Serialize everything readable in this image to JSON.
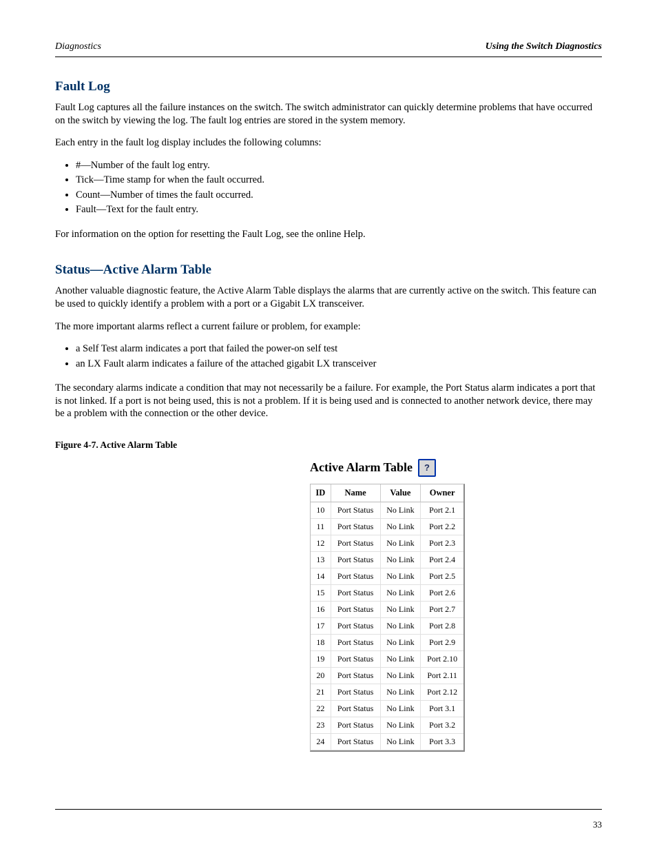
{
  "header": {
    "left": "Diagnostics",
    "right": "Using the Switch Diagnostics"
  },
  "footer": {
    "page": "33"
  },
  "section1": {
    "heading": "Fault Log",
    "p1": "Fault Log captures all the failure instances on the switch. The switch administrator can quickly determine problems that have occurred on the switch by viewing the log. The fault log entries are stored in the system memory.",
    "p2": "Each entry in the fault log display includes the following columns:",
    "bullets": [
      "#—Number of the fault log entry.",
      "Tick—Time stamp for when the fault occurred.",
      "Count—Number of times the fault occurred.",
      "Fault—Text for the fault entry."
    ],
    "p3": "For information on the option for resetting the Fault Log, see the online Help."
  },
  "section2": {
    "heading": "Status—Active Alarm Table",
    "p1": "Another valuable diagnostic feature, the Active Alarm Table displays the alarms that are currently active on the switch. This feature can be used to quickly identify a problem with a port or a Gigabit LX transceiver.",
    "p2": "The more important alarms reflect a current failure or problem, for example:",
    "bullets": [
      "a Self Test alarm indicates a port that failed the power-on self test",
      "an LX Fault alarm indicates a failure of the attached gigabit LX transceiver"
    ],
    "p3": "The secondary alarms indicate a condition that may not necessarily be a failure. For example, the Port Status alarm indicates a port that is not linked. If a port is not being used, this is not a problem. If it is being used and is connected to another network device, there may be a problem with the connection or the other device.",
    "fig_label": "Figure 4-7.  Active Alarm Table",
    "fig_title": "Active Alarm Table",
    "table": {
      "headers": [
        "ID",
        "Name",
        "Value",
        "Owner"
      ],
      "rows": [
        {
          "id": "10",
          "name": "Port Status",
          "value": "No Link",
          "owner": "Port 2.1"
        },
        {
          "id": "11",
          "name": "Port Status",
          "value": "No Link",
          "owner": "Port 2.2"
        },
        {
          "id": "12",
          "name": "Port Status",
          "value": "No Link",
          "owner": "Port 2.3"
        },
        {
          "id": "13",
          "name": "Port Status",
          "value": "No Link",
          "owner": "Port 2.4"
        },
        {
          "id": "14",
          "name": "Port Status",
          "value": "No Link",
          "owner": "Port 2.5"
        },
        {
          "id": "15",
          "name": "Port Status",
          "value": "No Link",
          "owner": "Port 2.6"
        },
        {
          "id": "16",
          "name": "Port Status",
          "value": "No Link",
          "owner": "Port 2.7"
        },
        {
          "id": "17",
          "name": "Port Status",
          "value": "No Link",
          "owner": "Port 2.8"
        },
        {
          "id": "18",
          "name": "Port Status",
          "value": "No Link",
          "owner": "Port 2.9"
        },
        {
          "id": "19",
          "name": "Port Status",
          "value": "No Link",
          "owner": "Port 2.10"
        },
        {
          "id": "20",
          "name": "Port Status",
          "value": "No Link",
          "owner": "Port 2.11"
        },
        {
          "id": "21",
          "name": "Port Status",
          "value": "No Link",
          "owner": "Port 2.12"
        },
        {
          "id": "22",
          "name": "Port Status",
          "value": "No Link",
          "owner": "Port 3.1"
        },
        {
          "id": "23",
          "name": "Port Status",
          "value": "No Link",
          "owner": "Port 3.2"
        },
        {
          "id": "24",
          "name": "Port Status",
          "value": "No Link",
          "owner": "Port 3.3"
        }
      ]
    }
  }
}
